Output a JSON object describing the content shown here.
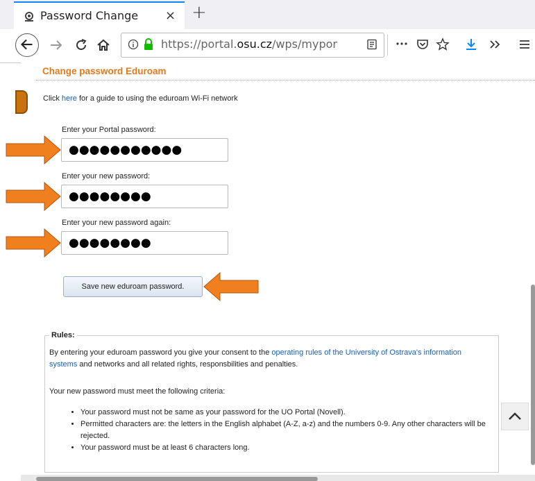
{
  "tab": {
    "title": "Password Change",
    "close": "×",
    "new_tab": "+"
  },
  "url": {
    "prefix": "https://portal.",
    "domain": "osu.cz",
    "path": "/wps/mypor"
  },
  "icons": {
    "back": "arrow-left-icon",
    "forward": "arrow-right-icon",
    "reload": "reload-icon",
    "home": "home-icon",
    "info": "info-icon",
    "lock": "lock-icon",
    "reader": "reader-icon",
    "more": "more-icon",
    "pocket": "pocket-icon",
    "star": "star-icon",
    "download": "download-icon",
    "overflow": "overflow-icon",
    "menu": "hamburger-icon"
  },
  "page": {
    "heading": "Change password Eduroam",
    "guide": {
      "pre": "Click ",
      "link": "here",
      "post": " for a guide to using the eduroam Wi-Fi network"
    },
    "fields": [
      {
        "label": "Enter your Portal password:",
        "value": "●●●●●●●●●●●"
      },
      {
        "label": "Enter your new password:",
        "value": "●●●●●●●●"
      },
      {
        "label": "Enter your new password again:",
        "value": "●●●●●●●●"
      }
    ],
    "save_button": "Save new eduroam password.",
    "rules": {
      "legend": "Rules:",
      "consent_pre": "By entering your eduroam password you give your consent to the ",
      "consent_link": "operating rules of the University of Ostrava's information systems",
      "consent_post": " and networks and all related rights, responsbilities and penalties.",
      "criteria_intro": "Your new password must meet the following criteria:",
      "items": [
        "Your password must not be same as your password for the UO Portal (Novell).",
        "Permitted characters are: the letters in the English alphabet (A-Z, a-z) and the numbers 0-9. Any other characters will be rejected.",
        "Your password must be at least 6 characters long."
      ]
    }
  },
  "colors": {
    "accent": "#e07a1b",
    "arrow": "#f07f1e",
    "link": "#1a5fb4"
  }
}
